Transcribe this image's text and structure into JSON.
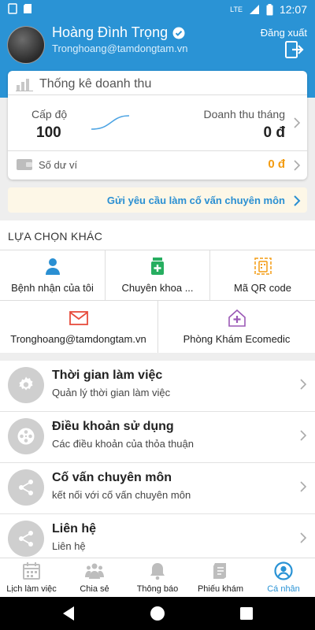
{
  "status_bar": {
    "time": "12:07",
    "network": "LTE"
  },
  "profile": {
    "name": "Hoàng Đình Trọng",
    "email": "Tronghoang@tamdongtam.vn",
    "logout_label": "Đăng xuất"
  },
  "revenue_card": {
    "title": "Thống kê doanh thu",
    "level_label": "Cấp độ",
    "level_value": "100",
    "monthly_revenue_label": "Doanh thu tháng",
    "monthly_revenue_value": "0 đ",
    "wallet_label": "Số dư ví",
    "wallet_value": "0 đ"
  },
  "advisor_request": {
    "label": "Gửi yêu cầu làm cố vấn chuyên môn"
  },
  "other_options": {
    "title": "LỰA CHỌN KHÁC",
    "items": [
      {
        "label": "Bệnh nhận của tôi",
        "icon": "person-icon"
      },
      {
        "label": "Chuyên khoa ...",
        "icon": "medicine-bottle-icon"
      },
      {
        "label": "Mã QR code",
        "icon": "qr-code-icon"
      },
      {
        "label": "Tronghoang@tamdongtam.vn",
        "icon": "mail-icon"
      },
      {
        "label": "Phòng Khám Ecomedic",
        "icon": "clinic-icon"
      }
    ]
  },
  "menu": {
    "items": [
      {
        "title": "Thời gian làm việc",
        "subtitle": "Quản lý thời gian làm việc",
        "icon": "gear-icon"
      },
      {
        "title": "Điều khoản sử dụng",
        "subtitle": "Các điều khoản của thỏa thuận",
        "icon": "film-reel-icon"
      },
      {
        "title": "Cố vấn chuyên môn",
        "subtitle": "kết nối với cố vấn chuyên môn",
        "icon": "share-icon"
      },
      {
        "title": "Liên hệ",
        "subtitle": "Liên hệ",
        "icon": "share-icon"
      }
    ]
  },
  "bottom_nav": {
    "items": [
      {
        "label": "Lịch làm việc",
        "icon": "calendar-icon"
      },
      {
        "label": "Chia sẻ",
        "icon": "group-icon"
      },
      {
        "label": "Thông báo",
        "icon": "bell-icon"
      },
      {
        "label": "Phiếu khám",
        "icon": "document-icon"
      },
      {
        "label": "Cá nhân",
        "icon": "account-circle-icon"
      }
    ],
    "active_index": 4
  },
  "colors": {
    "primary": "#2a93d5",
    "accent_orange": "#f39c12",
    "advisor_bg": "#fdf7e7",
    "icon_blue": "#2a8fd2",
    "icon_green": "#27ae60",
    "icon_red": "#e74c3c",
    "icon_purple": "#9b59b6"
  }
}
